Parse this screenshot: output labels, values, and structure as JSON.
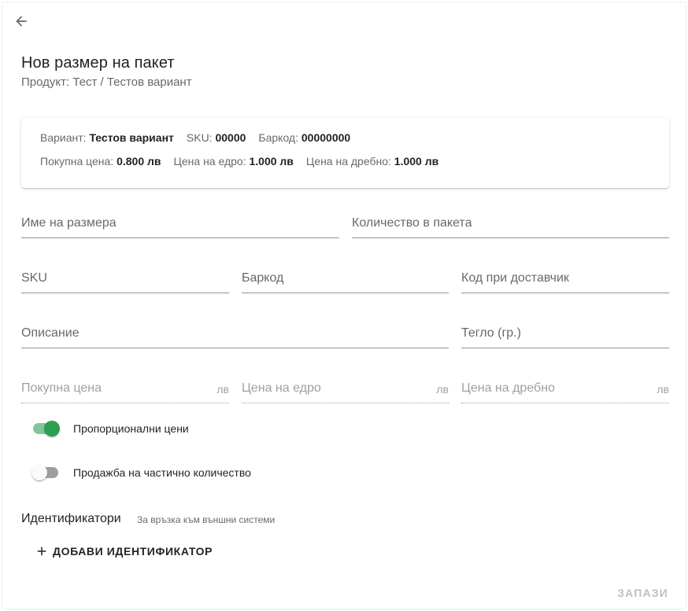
{
  "header": {
    "title": "Нов размер на пакет",
    "subtitle": "Продукт: Тест / Тестов вариант"
  },
  "info": {
    "variant_label": "Вариант:",
    "variant_value": "Тестов вариант",
    "sku_label": "SKU:",
    "sku_value": "00000",
    "barcode_label": "Баркод:",
    "barcode_value": "00000000",
    "purchase_label": "Покупна цена:",
    "purchase_value": "0.800 лв",
    "wholesale_label": "Цена на едро:",
    "wholesale_value": "1.000 лв",
    "retail_label": "Цена на дребно:",
    "retail_value": "1.000 лв"
  },
  "form": {
    "size_name": "Име на размера",
    "quantity_in_package": "Количество в пакета",
    "sku": "SKU",
    "barcode": "Баркод",
    "supplier_code": "Код при доставчик",
    "description": "Описание",
    "weight": "Тегло (гр.)",
    "purchase_price": "Покупна цена",
    "wholesale_price": "Цена на едро",
    "retail_price": "Цена на дребно",
    "currency_suffix": "лв"
  },
  "switches": {
    "proportional_prices": {
      "label": "Пропорционални цени",
      "on": true
    },
    "partial_quantity": {
      "label": "Продажба на частично количество",
      "on": false
    }
  },
  "identifiers": {
    "title": "Идентификатори",
    "hint": "За връзка към външни системи",
    "add_button": "ДОБАВИ ИДЕНТИФИКАТОР"
  },
  "actions": {
    "save": "ЗАПАЗИ"
  },
  "icons": {
    "back": "arrow-left-icon",
    "add": "plus-icon"
  },
  "colors": {
    "accent": "#2e9d4e",
    "accent_track": "#7fc69a"
  }
}
